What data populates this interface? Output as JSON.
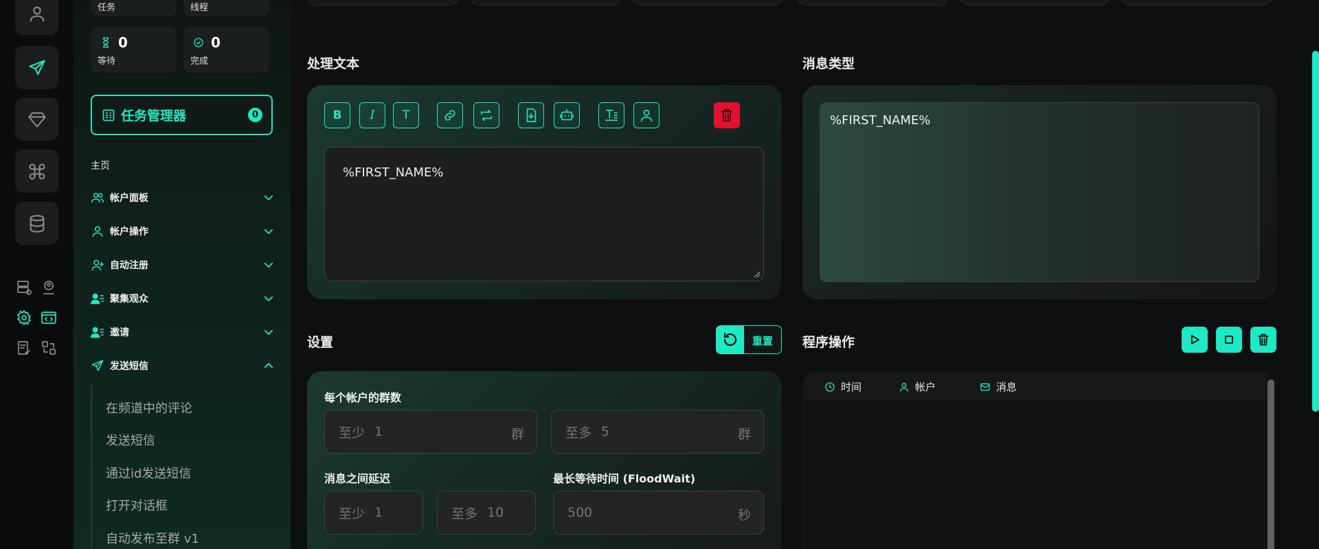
{
  "colors": {
    "accent": "#1de9c4",
    "danger": "#e3102f",
    "background": "#0e0f10"
  },
  "rail": {
    "buttons": [
      "user-icon",
      "send-icon",
      "diamond-icon",
      "command-icon",
      "database-icon"
    ],
    "mini_icons": [
      "server-check-icon",
      "user-circle-icon",
      "gear-icon",
      "code-window-icon",
      "file-check-icon",
      "swap-icon"
    ]
  },
  "stats": [
    {
      "label": "任务",
      "value": ""
    },
    {
      "label": "线程",
      "value": ""
    },
    {
      "label": "等待",
      "value": "0"
    },
    {
      "label": "完成",
      "value": "0"
    }
  ],
  "task_manager": {
    "label": "任务管理器",
    "count": "0"
  },
  "nav": {
    "home": "主页",
    "items": [
      {
        "label": "帐户面板",
        "icon": "users-icon"
      },
      {
        "label": "帐户操作",
        "icon": "user-icon"
      },
      {
        "label": "自动注册",
        "icon": "user-plus-icon"
      },
      {
        "label": "聚集观众",
        "icon": "user-list-icon"
      },
      {
        "label": "邀请",
        "icon": "user-list-icon"
      },
      {
        "label": "发送短信",
        "icon": "send-icon"
      }
    ],
    "submenu": [
      "在频道中的评论",
      "发送短信",
      "通过id发送短信",
      "打开对话框",
      "自动发布至群 v1"
    ]
  },
  "process_text": {
    "title": "处理文本",
    "toolbar": [
      "B",
      "I",
      "T"
    ],
    "content": "%FIRST_NAME%"
  },
  "message_type": {
    "title": "消息类型",
    "preview": "%FIRST_NAME%"
  },
  "settings": {
    "title": "设置",
    "reset_label": "重置",
    "groups_per_account": {
      "label": "每个帐户的群数",
      "min_prefix": "至少",
      "min_value": "1",
      "min_suffix": "群",
      "max_prefix": "至多",
      "max_value": "5",
      "max_suffix": "群"
    },
    "delay": {
      "label": "消息之间延迟",
      "min_prefix": "至少",
      "min_value": "1",
      "max_prefix": "至多",
      "max_value": "10"
    },
    "floodwait": {
      "label": "最长等待时间 (FloodWait)",
      "value": "500",
      "suffix": "秒"
    }
  },
  "program_ops": {
    "title": "程序操作",
    "columns": [
      "时间",
      "帐户",
      "消息"
    ]
  }
}
